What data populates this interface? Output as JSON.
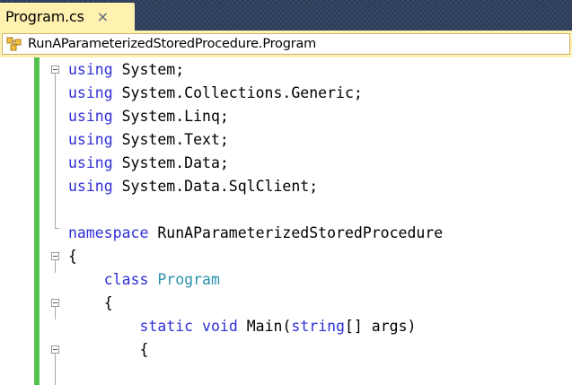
{
  "tab": {
    "title": "Program.cs",
    "close": "×"
  },
  "navbar": {
    "type_path": "RunAParameterizedStoredProcedure.Program"
  },
  "editor": {
    "lines": [
      [
        {
          "t": "using",
          "k": "kw"
        },
        {
          "t": " System;"
        }
      ],
      [
        {
          "t": "using",
          "k": "kw"
        },
        {
          "t": " System.Collections.Generic;"
        }
      ],
      [
        {
          "t": "using",
          "k": "kw"
        },
        {
          "t": " System.Linq;"
        }
      ],
      [
        {
          "t": "using",
          "k": "kw"
        },
        {
          "t": " System.Text;"
        }
      ],
      [
        {
          "t": "using",
          "k": "kw"
        },
        {
          "t": " System.Data;"
        }
      ],
      [
        {
          "t": "using",
          "k": "kw"
        },
        {
          "t": " System.Data.SqlClient;"
        }
      ],
      [],
      [
        {
          "t": "namespace",
          "k": "kw"
        },
        {
          "t": " RunAParameterizedStoredProcedure"
        }
      ],
      [
        {
          "t": "{"
        }
      ],
      [
        {
          "t": "    "
        },
        {
          "t": "class",
          "k": "kw"
        },
        {
          "t": " "
        },
        {
          "t": "Program",
          "k": "ty"
        }
      ],
      [
        {
          "t": "    {"
        }
      ],
      [
        {
          "t": "        "
        },
        {
          "t": "static",
          "k": "kw"
        },
        {
          "t": " "
        },
        {
          "t": "void",
          "k": "kw"
        },
        {
          "t": " Main("
        },
        {
          "t": "string",
          "k": "kw"
        },
        {
          "t": "[] args)"
        }
      ],
      [
        {
          "t": "        {"
        }
      ]
    ]
  }
}
